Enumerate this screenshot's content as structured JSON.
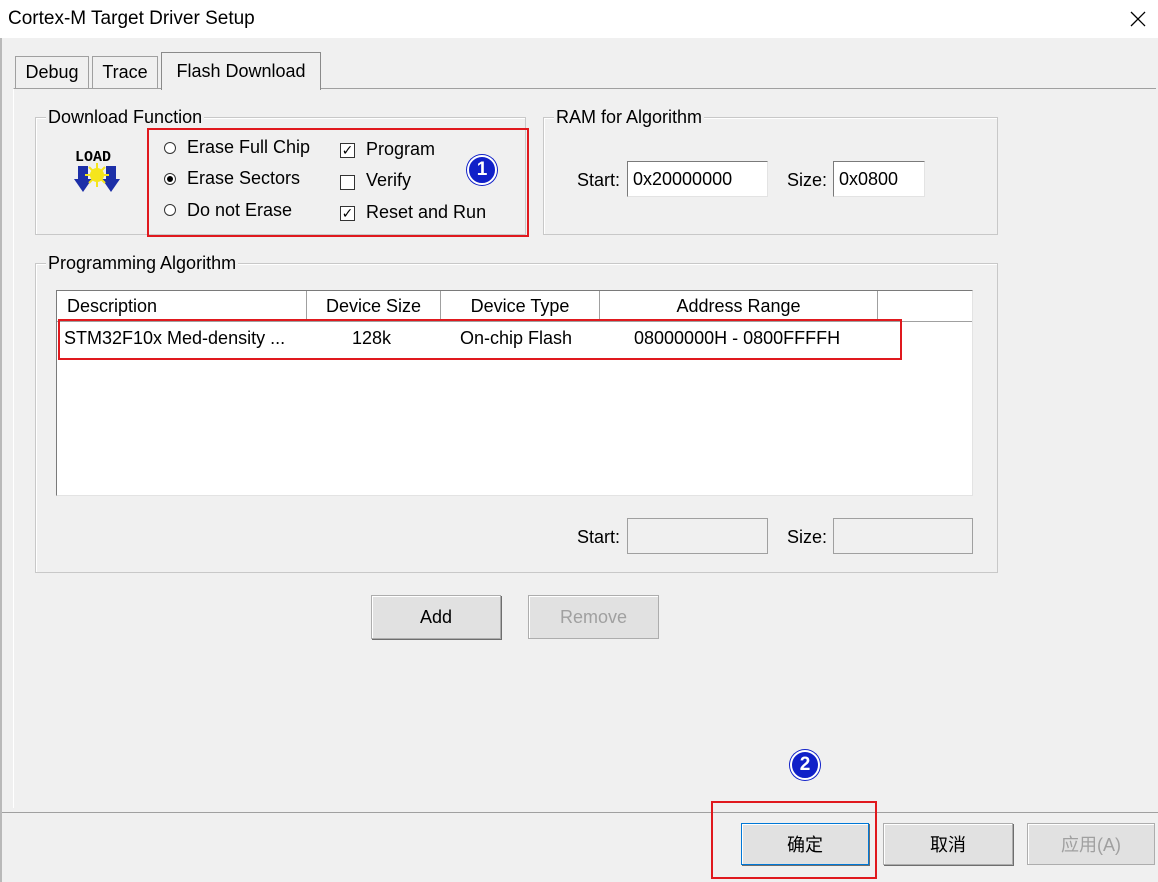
{
  "window": {
    "title": "Cortex-M Target Driver Setup",
    "close_glyph": "✕"
  },
  "tabs": [
    {
      "label": "Debug",
      "active": false
    },
    {
      "label": "Trace",
      "active": false
    },
    {
      "label": "Flash Download",
      "active": true
    }
  ],
  "download_function": {
    "title": "Download Function",
    "icon_text": "LOAD",
    "erase_options": [
      {
        "label": "Erase Full Chip",
        "selected": false
      },
      {
        "label": "Erase Sectors",
        "selected": true
      },
      {
        "label": "Do not Erase",
        "selected": false
      }
    ],
    "checks": [
      {
        "label": "Program",
        "checked": true
      },
      {
        "label": "Verify",
        "checked": false
      },
      {
        "label": "Reset and Run",
        "checked": true
      }
    ]
  },
  "ram": {
    "title": "RAM for Algorithm",
    "start_label": "Start:",
    "start_value": "0x20000000",
    "size_label": "Size:",
    "size_value": "0x0800"
  },
  "programming_algorithm": {
    "title": "Programming Algorithm",
    "columns": [
      "Description",
      "Device Size",
      "Device Type",
      "Address Range"
    ],
    "rows": [
      {
        "description": "STM32F10x Med-density ...",
        "device_size": "128k",
        "device_type": "On-chip Flash",
        "address_range": "08000000H - 0800FFFFH"
      }
    ],
    "start_label": "Start:",
    "start_value": "",
    "size_label": "Size:",
    "size_value": ""
  },
  "buttons": {
    "add": "Add",
    "remove": "Remove",
    "ok": "确定",
    "cancel": "取消",
    "apply": "应用(A)"
  },
  "annotations": {
    "badge1": "1",
    "badge2": "2"
  },
  "colors": {
    "annotation_red": "#e0191e",
    "badge_blue": "#1020c8",
    "dialog_bg": "#f0f0f0"
  }
}
